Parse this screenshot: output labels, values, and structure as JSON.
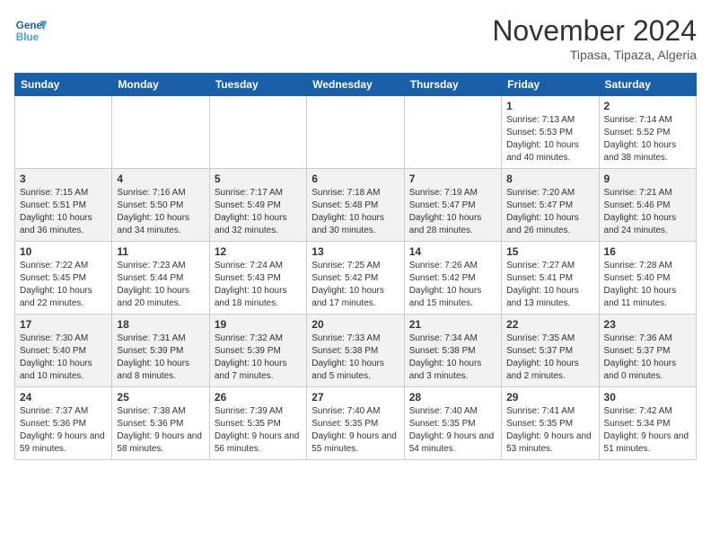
{
  "header": {
    "logo_line1": "General",
    "logo_line2": "Blue",
    "title": "November 2024",
    "subtitle": "Tipasa, Tipaza, Algeria"
  },
  "weekdays": [
    "Sunday",
    "Monday",
    "Tuesday",
    "Wednesday",
    "Thursday",
    "Friday",
    "Saturday"
  ],
  "weeks": [
    [
      {
        "day": "",
        "info": ""
      },
      {
        "day": "",
        "info": ""
      },
      {
        "day": "",
        "info": ""
      },
      {
        "day": "",
        "info": ""
      },
      {
        "day": "",
        "info": ""
      },
      {
        "day": "1",
        "info": "Sunrise: 7:13 AM\nSunset: 5:53 PM\nDaylight: 10 hours and 40 minutes."
      },
      {
        "day": "2",
        "info": "Sunrise: 7:14 AM\nSunset: 5:52 PM\nDaylight: 10 hours and 38 minutes."
      }
    ],
    [
      {
        "day": "3",
        "info": "Sunrise: 7:15 AM\nSunset: 5:51 PM\nDaylight: 10 hours and 36 minutes."
      },
      {
        "day": "4",
        "info": "Sunrise: 7:16 AM\nSunset: 5:50 PM\nDaylight: 10 hours and 34 minutes."
      },
      {
        "day": "5",
        "info": "Sunrise: 7:17 AM\nSunset: 5:49 PM\nDaylight: 10 hours and 32 minutes."
      },
      {
        "day": "6",
        "info": "Sunrise: 7:18 AM\nSunset: 5:48 PM\nDaylight: 10 hours and 30 minutes."
      },
      {
        "day": "7",
        "info": "Sunrise: 7:19 AM\nSunset: 5:47 PM\nDaylight: 10 hours and 28 minutes."
      },
      {
        "day": "8",
        "info": "Sunrise: 7:20 AM\nSunset: 5:47 PM\nDaylight: 10 hours and 26 minutes."
      },
      {
        "day": "9",
        "info": "Sunrise: 7:21 AM\nSunset: 5:46 PM\nDaylight: 10 hours and 24 minutes."
      }
    ],
    [
      {
        "day": "10",
        "info": "Sunrise: 7:22 AM\nSunset: 5:45 PM\nDaylight: 10 hours and 22 minutes."
      },
      {
        "day": "11",
        "info": "Sunrise: 7:23 AM\nSunset: 5:44 PM\nDaylight: 10 hours and 20 minutes."
      },
      {
        "day": "12",
        "info": "Sunrise: 7:24 AM\nSunset: 5:43 PM\nDaylight: 10 hours and 18 minutes."
      },
      {
        "day": "13",
        "info": "Sunrise: 7:25 AM\nSunset: 5:42 PM\nDaylight: 10 hours and 17 minutes."
      },
      {
        "day": "14",
        "info": "Sunrise: 7:26 AM\nSunset: 5:42 PM\nDaylight: 10 hours and 15 minutes."
      },
      {
        "day": "15",
        "info": "Sunrise: 7:27 AM\nSunset: 5:41 PM\nDaylight: 10 hours and 13 minutes."
      },
      {
        "day": "16",
        "info": "Sunrise: 7:28 AM\nSunset: 5:40 PM\nDaylight: 10 hours and 11 minutes."
      }
    ],
    [
      {
        "day": "17",
        "info": "Sunrise: 7:30 AM\nSunset: 5:40 PM\nDaylight: 10 hours and 10 minutes."
      },
      {
        "day": "18",
        "info": "Sunrise: 7:31 AM\nSunset: 5:39 PM\nDaylight: 10 hours and 8 minutes."
      },
      {
        "day": "19",
        "info": "Sunrise: 7:32 AM\nSunset: 5:39 PM\nDaylight: 10 hours and 7 minutes."
      },
      {
        "day": "20",
        "info": "Sunrise: 7:33 AM\nSunset: 5:38 PM\nDaylight: 10 hours and 5 minutes."
      },
      {
        "day": "21",
        "info": "Sunrise: 7:34 AM\nSunset: 5:38 PM\nDaylight: 10 hours and 3 minutes."
      },
      {
        "day": "22",
        "info": "Sunrise: 7:35 AM\nSunset: 5:37 PM\nDaylight: 10 hours and 2 minutes."
      },
      {
        "day": "23",
        "info": "Sunrise: 7:36 AM\nSunset: 5:37 PM\nDaylight: 10 hours and 0 minutes."
      }
    ],
    [
      {
        "day": "24",
        "info": "Sunrise: 7:37 AM\nSunset: 5:36 PM\nDaylight: 9 hours and 59 minutes."
      },
      {
        "day": "25",
        "info": "Sunrise: 7:38 AM\nSunset: 5:36 PM\nDaylight: 9 hours and 58 minutes."
      },
      {
        "day": "26",
        "info": "Sunrise: 7:39 AM\nSunset: 5:35 PM\nDaylight: 9 hours and 56 minutes."
      },
      {
        "day": "27",
        "info": "Sunrise: 7:40 AM\nSunset: 5:35 PM\nDaylight: 9 hours and 55 minutes."
      },
      {
        "day": "28",
        "info": "Sunrise: 7:40 AM\nSunset: 5:35 PM\nDaylight: 9 hours and 54 minutes."
      },
      {
        "day": "29",
        "info": "Sunrise: 7:41 AM\nSunset: 5:35 PM\nDaylight: 9 hours and 53 minutes."
      },
      {
        "day": "30",
        "info": "Sunrise: 7:42 AM\nSunset: 5:34 PM\nDaylight: 9 hours and 51 minutes."
      }
    ]
  ]
}
